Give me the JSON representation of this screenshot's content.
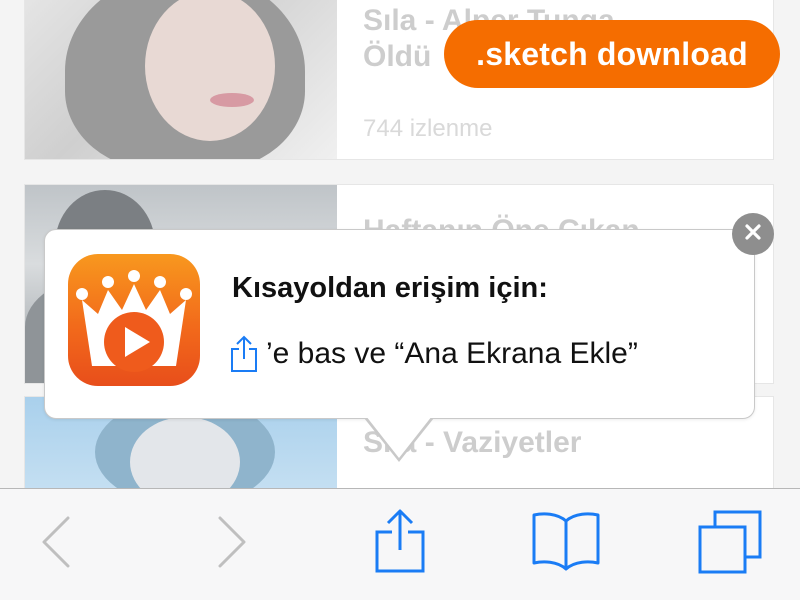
{
  "feed": {
    "items": [
      {
        "title_line1": "Sıla - Alper Tunga",
        "title_line2": "Öldü",
        "views": "744 izlenme"
      },
      {
        "title_line1": "Haftanın Öne Çıkan"
      },
      {
        "title_line1": "Sıla - Vaziyetler"
      }
    ]
  },
  "badge": {
    "label": ".sketch download"
  },
  "popup": {
    "title": "Kısayoldan erişim için:",
    "instruction": "’e bas ve “Ana Ekrana Ekle”"
  },
  "icons": {
    "app": "app-logo-icon",
    "close": "close-icon",
    "share": "share-icon",
    "back": "chevron-left-icon",
    "forward": "chevron-right-icon",
    "bookmarks": "book-icon",
    "tabs": "tabs-icon"
  },
  "colors": {
    "accent": "#f56d00",
    "ios_blue": "#1a7cf5",
    "disabled_gray": "#bfbfbf",
    "close_gray": "#8e8e8e"
  }
}
